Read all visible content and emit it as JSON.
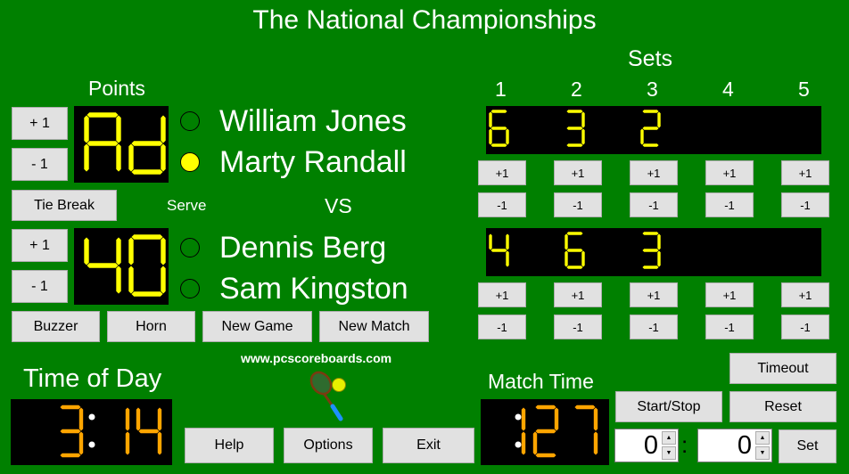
{
  "title": "The National Championships",
  "points": {
    "label": "Points",
    "team1_score": "Ad",
    "team2_score": "40",
    "plus_label": "+ 1",
    "minus_label": "- 1",
    "tie_break_label": "Tie Break",
    "segment_color": "#ffff00"
  },
  "serve_label": "Serve",
  "vs_label": "VS",
  "players": [
    {
      "name": "William Jones",
      "serving": false
    },
    {
      "name": "Marty Randall",
      "serving": true
    },
    {
      "name": "Dennis Berg",
      "serving": false
    },
    {
      "name": "Sam Kingston",
      "serving": false
    }
  ],
  "serve_color": "#ffff00",
  "sets": {
    "label": "Sets",
    "columns": [
      "1",
      "2",
      "3",
      "4",
      "5"
    ],
    "team1": [
      "6",
      "3",
      "2",
      "",
      ""
    ],
    "team2": [
      "4",
      "6",
      "3",
      "",
      ""
    ],
    "plus_label": "+1",
    "minus_label": "-1"
  },
  "buttons": {
    "buzzer": "Buzzer",
    "horn": "Horn",
    "new_game": "New Game",
    "new_match": "New Match",
    "help": "Help",
    "options": "Options",
    "exit": "Exit",
    "timeout": "Timeout",
    "start_stop": "Start/Stop",
    "reset": "Reset",
    "set": "Set"
  },
  "website": "www.pcscoreboards.com",
  "time_of_day": {
    "label": "Time of Day",
    "hours": "3",
    "minutes": "14"
  },
  "match_time": {
    "label": "Match Time",
    "hours": "1",
    "minutes": "27"
  },
  "clock_color": "#ffa500",
  "time_set": {
    "minutes_value": "0",
    "seconds_value": "0",
    "separator": ":"
  }
}
